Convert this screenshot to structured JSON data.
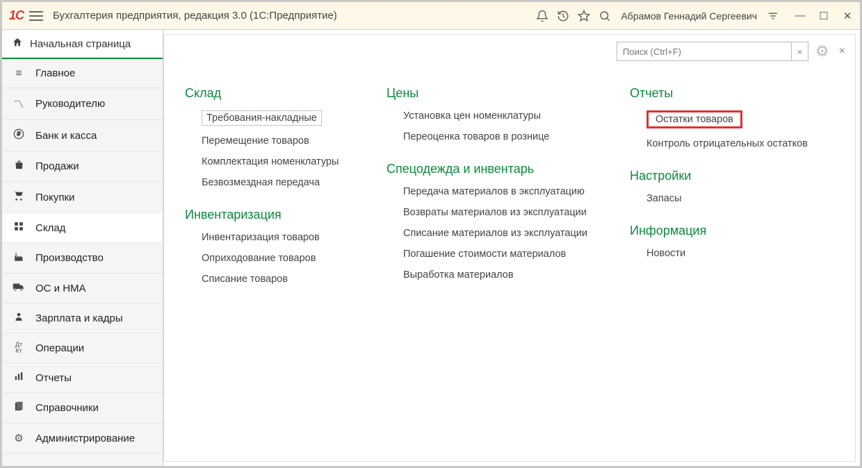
{
  "titlebar": {
    "app_title": "Бухгалтерия предприятия, редакция 3.0  (1С:Предприятие)",
    "user_name": "Абрамов Геннадий Сергеевич"
  },
  "sidebar": {
    "home_label": "Начальная страница",
    "items": [
      {
        "label": "Главное",
        "icon": "≡"
      },
      {
        "label": "Руководителю",
        "icon": "📈"
      },
      {
        "label": "Банк и касса",
        "icon": "₽"
      },
      {
        "label": "Продажи",
        "icon": "🛍"
      },
      {
        "label": "Покупки",
        "icon": "🛒"
      },
      {
        "label": "Склад",
        "icon": "▦",
        "active": true
      },
      {
        "label": "Производство",
        "icon": "🏭"
      },
      {
        "label": "ОС и НМА",
        "icon": "🚚"
      },
      {
        "label": "Зарплата и кадры",
        "icon": "👤"
      },
      {
        "label": "Операции",
        "icon": "Дт Кт"
      },
      {
        "label": "Отчеты",
        "icon": "📊"
      },
      {
        "label": "Справочники",
        "icon": "📚"
      },
      {
        "label": "Администрирование",
        "icon": "⚙"
      }
    ]
  },
  "search": {
    "placeholder": "Поиск (Ctrl+F)"
  },
  "content": {
    "col1": {
      "s1_title": "Склад",
      "s1_items": [
        "Требования-накладные",
        "Перемещение товаров",
        "Комплектация номенклатуры",
        "Безвозмездная передача"
      ],
      "s2_title": "Инвентаризация",
      "s2_items": [
        "Инвентаризация товаров",
        "Оприходование товаров",
        "Списание товаров"
      ]
    },
    "col2": {
      "s1_title": "Цены",
      "s1_items": [
        "Установка цен номенклатуры",
        "Переоценка товаров в рознице"
      ],
      "s2_title": "Спецодежда и инвентарь",
      "s2_items": [
        "Передача материалов в эксплуатацию",
        "Возвраты материалов из эксплуатации",
        "Списание материалов из эксплуатации",
        "Погашение стоимости материалов",
        "Выработка материалов"
      ]
    },
    "col3": {
      "s1_title": "Отчеты",
      "s1_items": [
        "Остатки товаров",
        "Контроль отрицательных остатков"
      ],
      "s2_title": "Настройки",
      "s2_items": [
        "Запасы"
      ],
      "s3_title": "Информация",
      "s3_items": [
        "Новости"
      ]
    }
  }
}
